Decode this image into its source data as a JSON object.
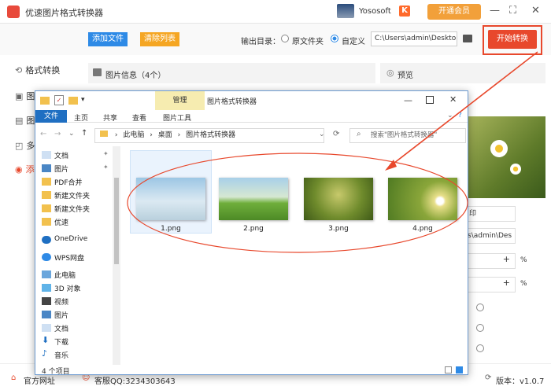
{
  "app": {
    "title": "优速图片格式转换器",
    "username": "Yososoft",
    "vip_label": "开通会员",
    "vip_icon": "vip-badge-icon",
    "window_controls": [
      "—",
      "⛶",
      "✕"
    ]
  },
  "toolbar": {
    "add_files": "添加文件",
    "clear_list": "清除列表",
    "output_label": "输出目录：",
    "opt_source": "原文件夹",
    "opt_custom": "自定义",
    "path_value": "C:\\Users\\admin\\Deskto",
    "start": "开始转换"
  },
  "sidebar": {
    "items": [
      {
        "label": "格式转换",
        "icon": "refresh-icon"
      },
      {
        "label": "图片压缩",
        "icon": "compress-icon"
      },
      {
        "label": "图片编辑",
        "icon": "edit-icon"
      },
      {
        "label": "多图合并",
        "icon": "image-icon"
      },
      {
        "label": "添加水印",
        "icon": "watermark-icon"
      }
    ]
  },
  "main": {
    "info_title": "图片信息（4个）",
    "preview_title": "预览",
    "right_fields": {
      "format_suffix": "印",
      "path_partial": "s\\admin\\Des",
      "plus": "+",
      "percent": "%"
    }
  },
  "footer": {
    "website": "官方网址",
    "qq": "客服QQ:3234303643",
    "version": "版本：v1.0.7"
  },
  "explorer": {
    "manage_tab": "管理",
    "title": "图片格式转换器",
    "ribbon_tabs": [
      "文件",
      "主页",
      "共享",
      "查看",
      "图片工具"
    ],
    "breadcrumb": [
      "此电脑",
      "桌面",
      "图片格式转换器"
    ],
    "search_placeholder": "搜索\"图片格式转换器\"",
    "nav": [
      {
        "label": "文档",
        "icon": "document-icon"
      },
      {
        "label": "图片",
        "icon": "picture-icon"
      },
      {
        "label": "PDF合并",
        "icon": "folder-icon"
      },
      {
        "label": "新建文件夹",
        "icon": "folder-icon"
      },
      {
        "label": "新建文件夹",
        "icon": "folder-icon"
      },
      {
        "label": "优速",
        "icon": "folder-icon"
      },
      {
        "label": "OneDrive",
        "icon": "cloud-icon"
      },
      {
        "label": "WPS网盘",
        "icon": "cloud-icon"
      },
      {
        "label": "此电脑",
        "icon": "computer-icon"
      },
      {
        "label": "3D 对象",
        "icon": "cube-icon"
      },
      {
        "label": "视频",
        "icon": "video-icon"
      },
      {
        "label": "图片",
        "icon": "picture-icon"
      },
      {
        "label": "文档",
        "icon": "document-icon"
      },
      {
        "label": "下载",
        "icon": "download-icon"
      },
      {
        "label": "音乐",
        "icon": "music-icon"
      }
    ],
    "files": [
      {
        "name": "1.png"
      },
      {
        "name": "2.png"
      },
      {
        "name": "3.png"
      },
      {
        "name": "4.png"
      }
    ],
    "status": "4 个项目"
  },
  "colors": {
    "accent_blue": "#2e8ae6",
    "accent_orange": "#f5a623",
    "start_red": "#e8482c",
    "annotation_red": "#e8482c"
  }
}
